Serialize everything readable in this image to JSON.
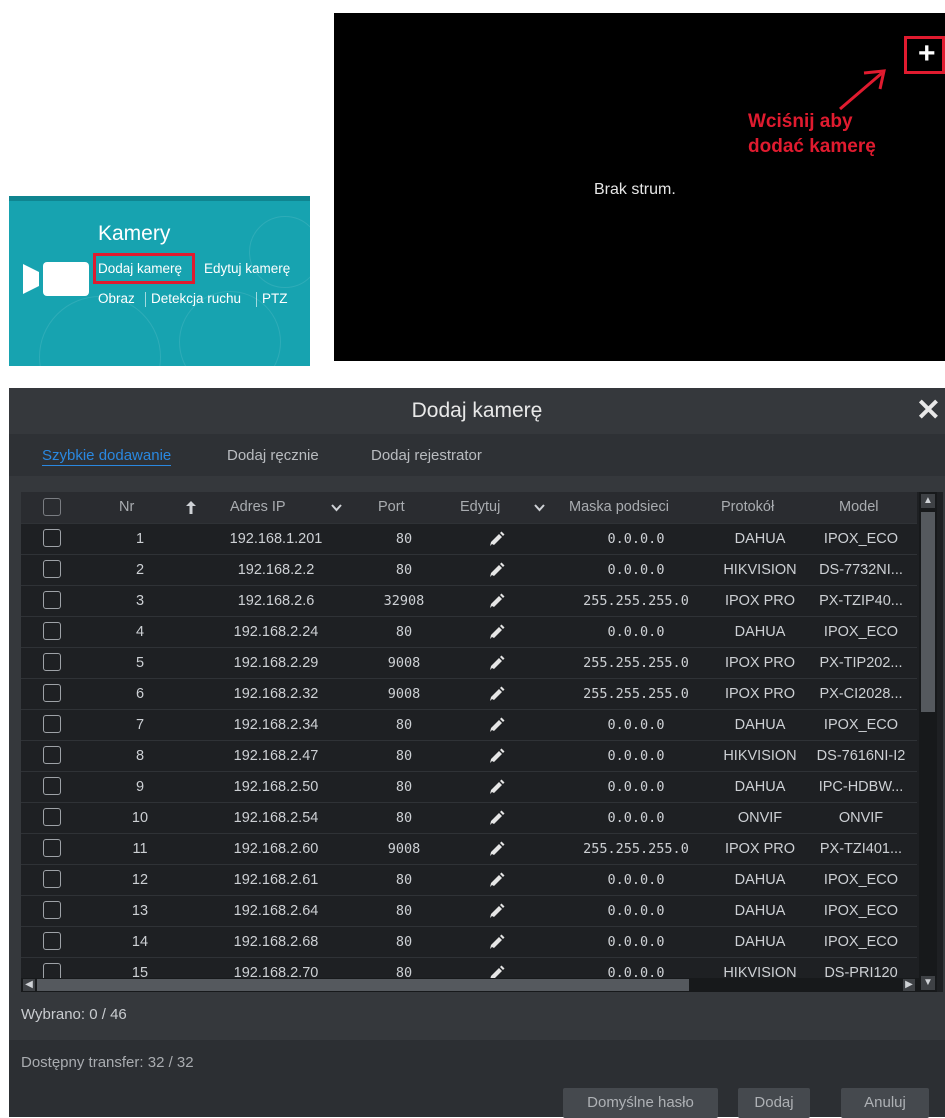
{
  "cameras_card": {
    "title": "Kamery",
    "add_camera": "Dodaj kamerę",
    "edit_camera": "Edytuj kamerę",
    "image": "Obraz",
    "motion_detection": "Detekcja ruchu",
    "ptz": "PTZ"
  },
  "preview": {
    "no_stream": "Brak strum.",
    "add_button": "+",
    "hint_line1": "Wciśnij aby",
    "hint_line2": "dodać kamerę",
    "hint_color": "#e01b2f"
  },
  "dialog": {
    "title": "Dodaj kamerę",
    "close_icon": "close-icon",
    "tabs": [
      {
        "label": "Szybkie dodawanie",
        "active": true
      },
      {
        "label": "Dodaj ręcznie",
        "active": false
      },
      {
        "label": "Dodaj rejestrator",
        "active": false
      }
    ],
    "columns": {
      "nr": "Nr",
      "ip": "Adres IP",
      "port": "Port",
      "edit": "Edytuj",
      "mask": "Maska podsieci",
      "protocol": "Protokół",
      "model": "Model"
    },
    "rows": [
      {
        "nr": "1",
        "ip": "192.168.1.201",
        "port": "80",
        "mask": "0.0.0.0",
        "protocol": "DAHUA",
        "model": "IPOX_ECO"
      },
      {
        "nr": "2",
        "ip": "192.168.2.2",
        "port": "80",
        "mask": "0.0.0.0",
        "protocol": "HIKVISION",
        "model": "DS-7732NI..."
      },
      {
        "nr": "3",
        "ip": "192.168.2.6",
        "port": "32908",
        "mask": "255.255.255.0",
        "protocol": "IPOX PRO",
        "model": "PX-TZIP40..."
      },
      {
        "nr": "4",
        "ip": "192.168.2.24",
        "port": "80",
        "mask": "0.0.0.0",
        "protocol": "DAHUA",
        "model": "IPOX_ECO"
      },
      {
        "nr": "5",
        "ip": "192.168.2.29",
        "port": "9008",
        "mask": "255.255.255.0",
        "protocol": "IPOX PRO",
        "model": "PX-TIP202..."
      },
      {
        "nr": "6",
        "ip": "192.168.2.32",
        "port": "9008",
        "mask": "255.255.255.0",
        "protocol": "IPOX PRO",
        "model": "PX-CI2028..."
      },
      {
        "nr": "7",
        "ip": "192.168.2.34",
        "port": "80",
        "mask": "0.0.0.0",
        "protocol": "DAHUA",
        "model": "IPOX_ECO"
      },
      {
        "nr": "8",
        "ip": "192.168.2.47",
        "port": "80",
        "mask": "0.0.0.0",
        "protocol": "HIKVISION",
        "model": "DS-7616NI-I2"
      },
      {
        "nr": "9",
        "ip": "192.168.2.50",
        "port": "80",
        "mask": "0.0.0.0",
        "protocol": "DAHUA",
        "model": "IPC-HDBW..."
      },
      {
        "nr": "10",
        "ip": "192.168.2.54",
        "port": "80",
        "mask": "0.0.0.0",
        "protocol": "ONVIF",
        "model": "ONVIF"
      },
      {
        "nr": "11",
        "ip": "192.168.2.60",
        "port": "9008",
        "mask": "255.255.255.0",
        "protocol": "IPOX PRO",
        "model": "PX-TZI401..."
      },
      {
        "nr": "12",
        "ip": "192.168.2.61",
        "port": "80",
        "mask": "0.0.0.0",
        "protocol": "DAHUA",
        "model": "IPOX_ECO"
      },
      {
        "nr": "13",
        "ip": "192.168.2.64",
        "port": "80",
        "mask": "0.0.0.0",
        "protocol": "DAHUA",
        "model": "IPOX_ECO"
      },
      {
        "nr": "14",
        "ip": "192.168.2.68",
        "port": "80",
        "mask": "0.0.0.0",
        "protocol": "DAHUA",
        "model": "IPOX_ECO"
      },
      {
        "nr": "15",
        "ip": "192.168.2.70",
        "port": "80",
        "mask": "0.0.0.0",
        "protocol": "HIKVISION",
        "model": "DS-PRI120"
      }
    ],
    "selected": "Wybrano: 0 / 46",
    "transfer": "Dostępny transfer: 32 / 32",
    "buttons": {
      "default_password": "Domyślne hasło",
      "add": "Dodaj",
      "cancel": "Anuluj"
    }
  }
}
